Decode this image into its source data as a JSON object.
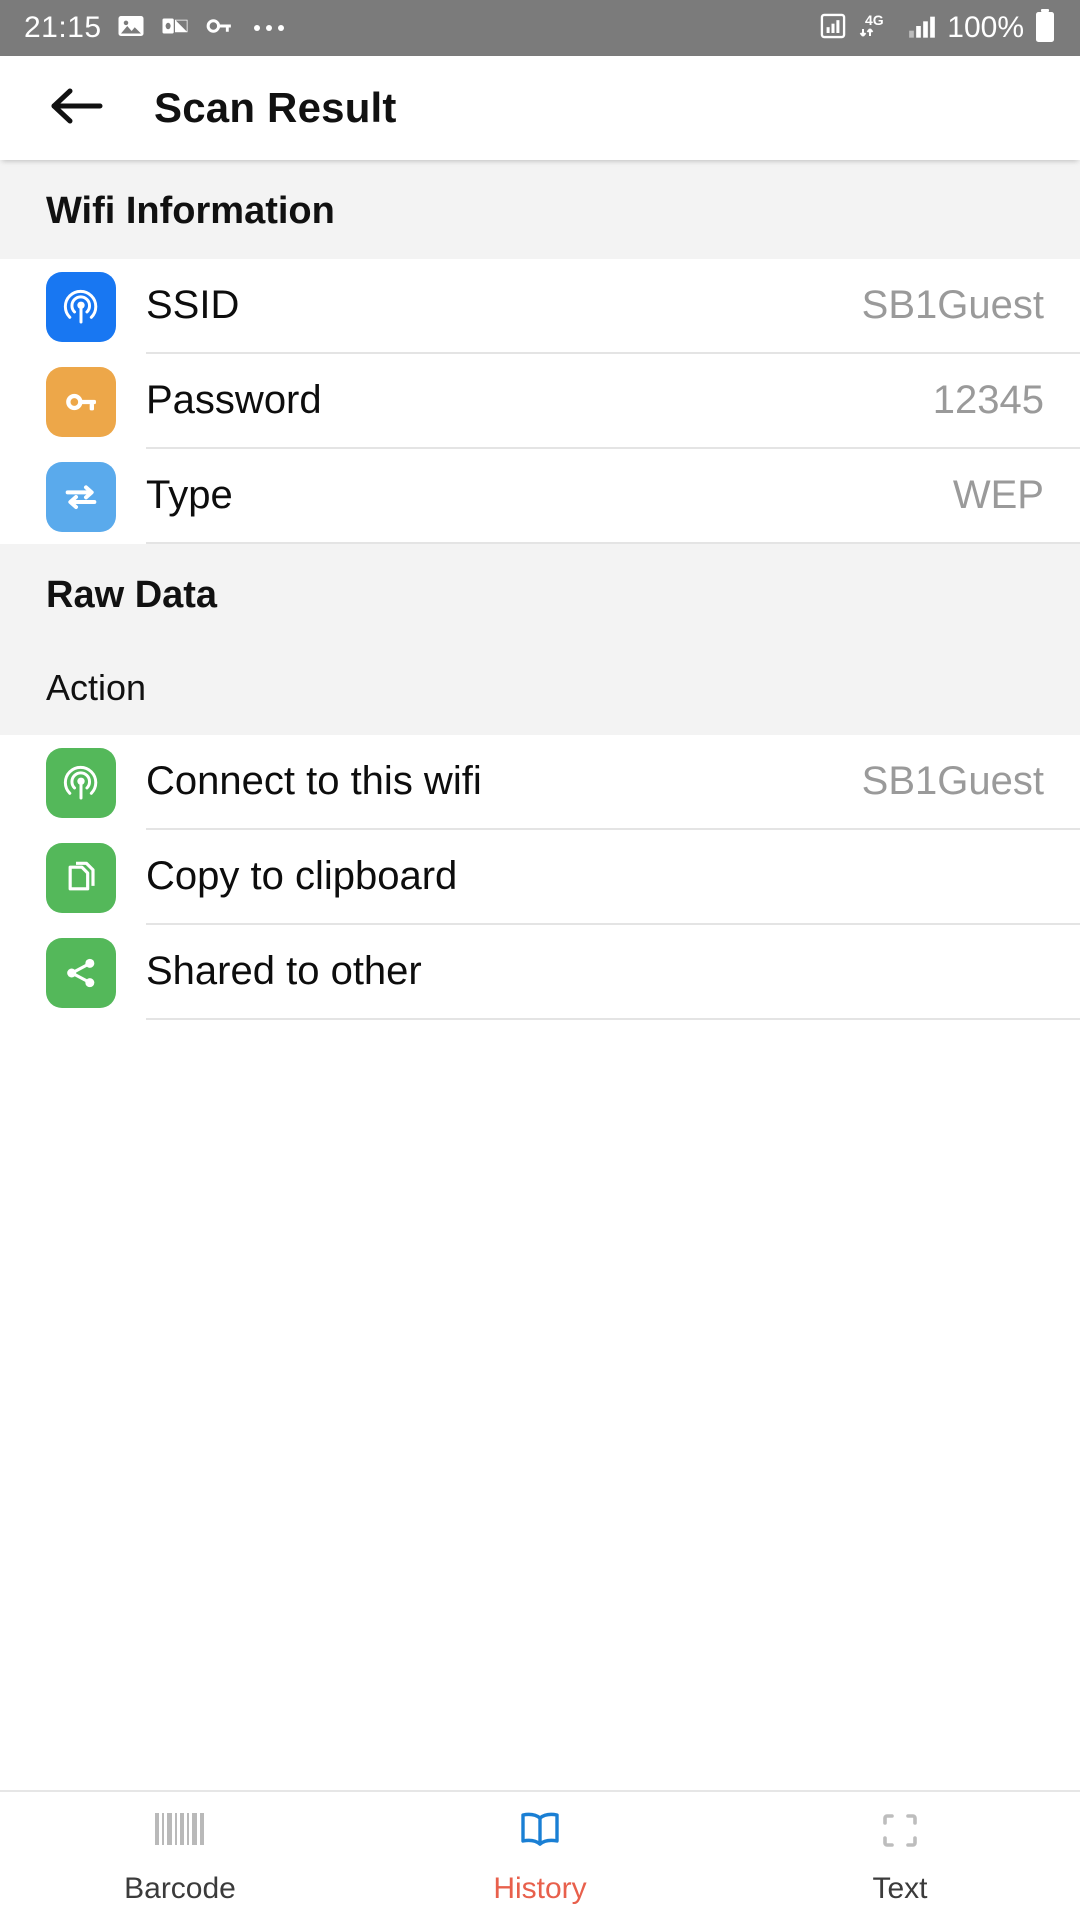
{
  "status_bar": {
    "time": "21:15",
    "battery_percent": "100%",
    "network": "4G",
    "icons": [
      "image-icon",
      "outlook-icon",
      "key-icon",
      "more-dots-icon",
      "sim-signal-icon",
      "network-4g-icon",
      "signal-bars-icon",
      "battery-icon"
    ]
  },
  "app_bar": {
    "back_icon": "arrow-left-icon",
    "title": "Scan Result"
  },
  "wifi_section": {
    "title": "Wifi Information",
    "rows": [
      {
        "icon": "wifi-broadcast-icon",
        "icon_color": "#1877f2",
        "label": "SSID",
        "value": "SB1Guest"
      },
      {
        "icon": "key-icon",
        "icon_color": "#eda749",
        "label": "Password",
        "value": "12345"
      },
      {
        "icon": "transfer-arrows-icon",
        "icon_color": "#5aaaec",
        "label": "Type",
        "value": "WEP"
      }
    ]
  },
  "raw_data_section": {
    "title": "Raw Data",
    "action_label": "Action",
    "rows": [
      {
        "icon": "wifi-broadcast-icon",
        "icon_color": "#54b85a",
        "label": "Connect to this wifi",
        "value": "SB1Guest"
      },
      {
        "icon": "copy-document-icon",
        "icon_color": "#54b85a",
        "label": "Copy to clipboard",
        "value": ""
      },
      {
        "icon": "share-icon",
        "icon_color": "#54b85a",
        "label": "Shared to other",
        "value": ""
      }
    ]
  },
  "bottom_nav": {
    "active_color": "#e8604c",
    "items": [
      {
        "icon": "barcode-icon",
        "label": "Barcode",
        "active": false
      },
      {
        "icon": "book-icon",
        "label": "History",
        "active": true
      },
      {
        "icon": "scan-frame-icon",
        "label": "Text",
        "active": false
      }
    ]
  }
}
